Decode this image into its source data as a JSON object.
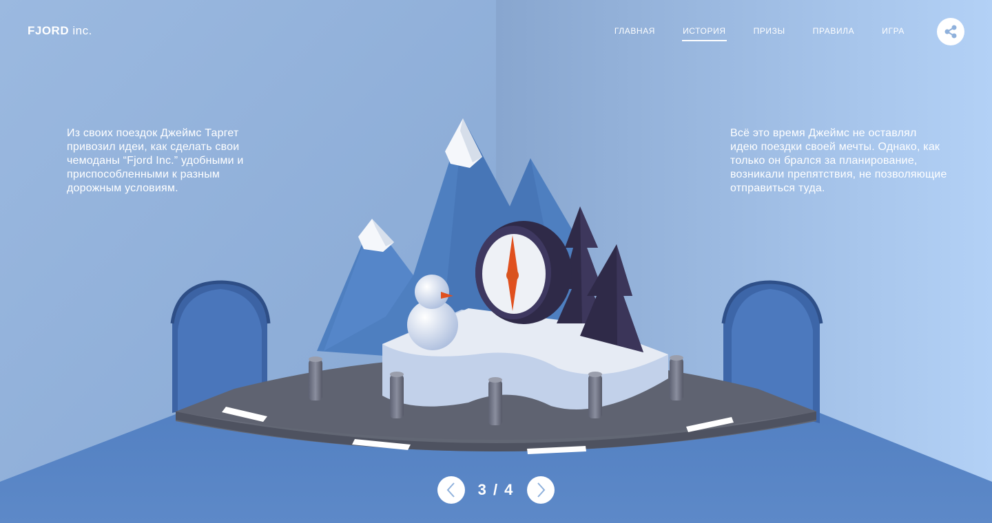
{
  "brand": {
    "logo_main": "FJORD",
    "logo_suffix": "inc."
  },
  "nav": {
    "items": [
      {
        "label": "ГЛАВНАЯ",
        "active": false
      },
      {
        "label": "ИСТОРИЯ",
        "active": true
      },
      {
        "label": "ПРИЗЫ",
        "active": false
      },
      {
        "label": "ПРАВИЛА",
        "active": false
      },
      {
        "label": "ИГРА",
        "active": false
      }
    ]
  },
  "share": {
    "icon": "share-icon"
  },
  "story": {
    "left_text": "Из своих поездок Джеймс Таргет привозил идеи, как сделать свои чемоданы “Fjord Inc.” удобными и приспособленными к разным дорожным условиям.",
    "right_text": "Всё это время Джеймс не оставлял идею поездки своей мечты. Однако, как только он брался за планирование, возникали препятствия, не позволяющие отправиться туда."
  },
  "pager": {
    "current": 3,
    "total": 4,
    "label": "3 / 4",
    "prev_icon": "chevron-left-icon",
    "next_icon": "chevron-right-icon"
  },
  "colors": {
    "accent": "#ffffff",
    "sky": "#92b2da",
    "floor": "#5b86c6",
    "road": "#6b6f7e",
    "compass_needle": "#e0501e",
    "trees": "#2f2a48"
  }
}
